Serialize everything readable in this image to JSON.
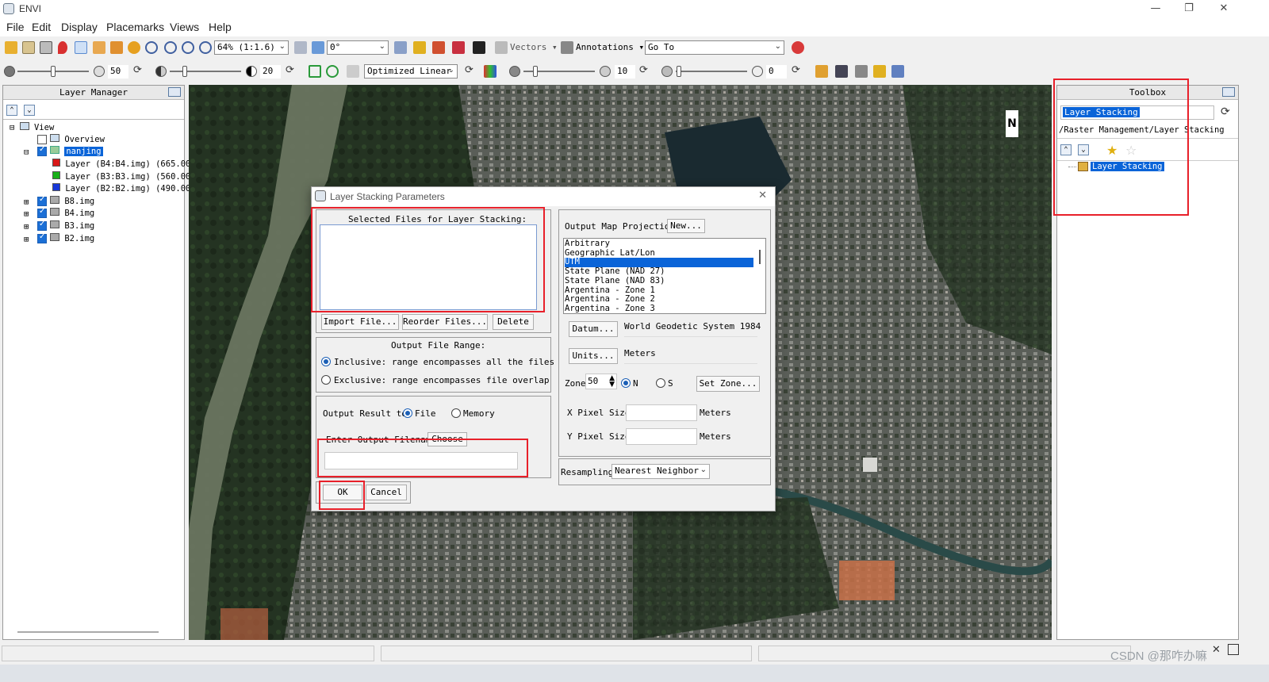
{
  "app": {
    "title": "ENVI"
  },
  "menu": [
    "File",
    "Edit",
    "Display",
    "Placemarks",
    "Views",
    "Help"
  ],
  "toolbar1": {
    "zoom_value": "64% (1:1.6)",
    "rotation_value": "0°",
    "vectors_label": "Vectors",
    "annotations_label": "Annotations",
    "goto_label": "Go To"
  },
  "toolbar2": {
    "brightness_value": "50",
    "contrast_value": "20",
    "stretch_value": "Optimized Linear",
    "sharpen_value": "10",
    "transparency_value": "0"
  },
  "layer_manager": {
    "title": "Layer Manager",
    "tree": {
      "view_label": "View",
      "overview_label": "Overview",
      "raster_name": "nanjing",
      "bands": [
        {
          "label": "Layer  (B4:B4.img)  (665.00",
          "color": "#d91818"
        },
        {
          "label": "Layer  (B3:B3.img)  (560.00",
          "color": "#18b018"
        },
        {
          "label": "Layer  (B2:B2.img)  (490.00",
          "color": "#1838d8"
        }
      ],
      "images": [
        "B8.img",
        "B4.img",
        "B3.img",
        "B2.img"
      ]
    }
  },
  "toolbox": {
    "title": "Toolbox",
    "search_value": "Layer Stacking",
    "path": "/Raster Management/Layer Stacking",
    "result_label": "Layer Stacking"
  },
  "dialog": {
    "title": "Layer Stacking Parameters",
    "selected_files_label": "Selected Files for Layer Stacking:",
    "import_button": "Import File...",
    "reorder_button": "Reorder Files...",
    "delete_button": "Delete",
    "range_title": "Output File Range:",
    "inclusive_label": "Inclusive: range encompasses all the files",
    "exclusive_label": "Exclusive: range encompasses file overlap",
    "output_result_label": "Output Result to",
    "file_option": "File",
    "memory_option": "Memory",
    "filename_label": "Enter Output Filename",
    "choose_button": "Choose",
    "ok_button": "OK",
    "cancel_button": "Cancel",
    "projection_label": "Output Map Projection",
    "new_button": "New...",
    "projections": [
      "Arbitrary",
      "Geographic Lat/Lon",
      "UTM",
      "State Plane (NAD 27)",
      "State Plane (NAD 83)",
      "Argentina - Zone 1",
      "Argentina - Zone 2",
      "Argentina - Zone 3"
    ],
    "selected_projection": "UTM",
    "datum_button": "Datum...",
    "datum_value": "World Geodetic System 1984",
    "units_button": "Units...",
    "units_value": "Meters",
    "zone_label": "Zone",
    "zone_value": "50",
    "north_label": "N",
    "south_label": "S",
    "set_zone_button": "Set Zone...",
    "x_pixel_label": "X Pixel Size",
    "y_pixel_label": "Y Pixel Size",
    "x_pixel_units": "Meters",
    "y_pixel_units": "Meters",
    "resampling_label": "Resampling",
    "resampling_value": "Nearest Neighbor"
  },
  "watermark": "CSDN @那咋办嘛",
  "north_arrow_label": "N"
}
